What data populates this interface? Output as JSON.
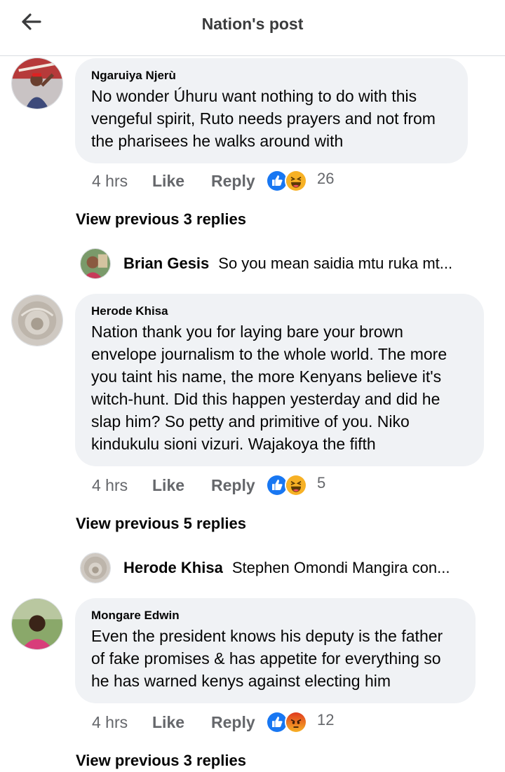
{
  "header": {
    "title": "Nation's post",
    "back_icon": "arrow-left-icon"
  },
  "colors": {
    "like_blue": "#1877f2",
    "haha_yellow": "#f7b125",
    "angry_orange": "#e9710f",
    "meta_gray": "#65676b",
    "bubble_bg": "#f0f2f5"
  },
  "comments": [
    {
      "author": "Ngaruiya Njerù",
      "text": "No wonder Úhuru want nothing to do with this vengeful spirit, Ruto needs prayers and not from the pharisees he walks around with",
      "time": "4 hrs",
      "like": "Like",
      "reply": "Reply",
      "reactions": [
        "like",
        "haha"
      ],
      "reaction_count": "26",
      "view_previous": "View previous 3 replies",
      "reply_preview": {
        "author": "Brian Gesis",
        "text": "So you mean saidia mtu ruka mt..."
      }
    },
    {
      "author": "Herode Khisa",
      "text": "Nation thank you for laying bare your brown envelope journalism to the whole world. The more you taint his name, the more  Kenyans believe it's witch-hunt. Did this happen yesterday and did he slap him? So petty and primitive of you. Niko kindukulu sioni vizuri. Wajakoya the fifth",
      "time": "4 hrs",
      "like": "Like",
      "reply": "Reply",
      "reactions": [
        "like",
        "haha"
      ],
      "reaction_count": "5",
      "view_previous": "View previous 5 replies",
      "reply_preview": {
        "author": "Herode Khisa",
        "text": "Stephen Omondi Mangira con..."
      }
    },
    {
      "author": "Mongare Edwin",
      "text": "Even the president knows his deputy is the father of fake promises & has appetite for everything so he has warned kenys against electing him",
      "time": "4 hrs",
      "like": "Like",
      "reply": "Reply",
      "reactions": [
        "like",
        "angry"
      ],
      "reaction_count": "12",
      "view_previous": "View previous 3 replies"
    }
  ]
}
